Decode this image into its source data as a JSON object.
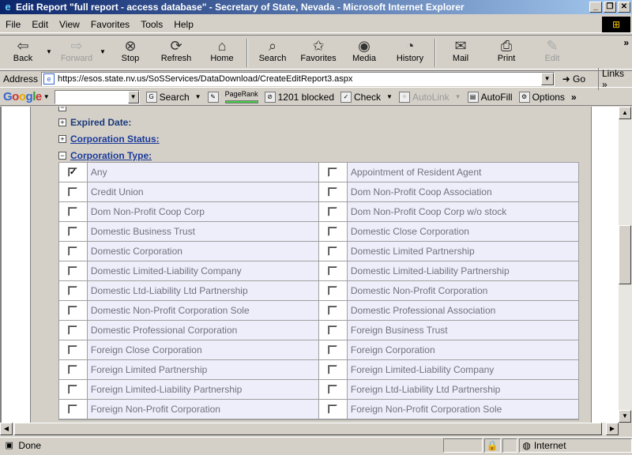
{
  "window": {
    "title": "Edit Report \"full report - access database\" - Secretary of State, Nevada - Microsoft Internet Explorer",
    "controls": [
      "_",
      "❐",
      "✕"
    ]
  },
  "menu": [
    "File",
    "Edit",
    "View",
    "Favorites",
    "Tools",
    "Help"
  ],
  "toolbar": {
    "back": "Back",
    "forward": "Forward",
    "stop": "Stop",
    "refresh": "Refresh",
    "home": "Home",
    "search": "Search",
    "favorites": "Favorites",
    "media": "Media",
    "history": "History",
    "mail": "Mail",
    "print": "Print",
    "edit": "Edit",
    "more": "»"
  },
  "address": {
    "label": "Address",
    "url": "https://esos.state.nv.us/SoSServices/DataDownload/CreateEditReport3.aspx",
    "go": "Go",
    "links": "Links »"
  },
  "googlebar": {
    "logo": [
      "G",
      "o",
      "o",
      "g",
      "l",
      "e"
    ],
    "search": "Search",
    "pagerank": "PageRank",
    "blocked": "1201 blocked",
    "check": "Check",
    "autolink": "AutoLink",
    "autofill": "AutoFill",
    "options": "Options",
    "more": "»"
  },
  "form": {
    "sections": {
      "expired": "Expired Date:",
      "status": "Corporation Status:",
      "type": "Corporation Type:"
    },
    "rows": [
      {
        "left": {
          "label": "Any",
          "checked": true
        },
        "right": {
          "label": "Appointment of Resident Agent",
          "checked": false
        }
      },
      {
        "left": {
          "label": "Credit Union",
          "checked": false
        },
        "right": {
          "label": "Dom Non-Profit Coop Association",
          "checked": false
        }
      },
      {
        "left": {
          "label": "Dom Non-Profit Coop Corp",
          "checked": false
        },
        "right": {
          "label": "Dom Non-Profit Coop Corp w/o stock",
          "checked": false
        }
      },
      {
        "left": {
          "label": "Domestic Business Trust",
          "checked": false
        },
        "right": {
          "label": "Domestic Close Corporation",
          "checked": false
        }
      },
      {
        "left": {
          "label": "Domestic Corporation",
          "checked": false
        },
        "right": {
          "label": "Domestic Limited Partnership",
          "checked": false
        }
      },
      {
        "left": {
          "label": "Domestic Limited-Liability Company",
          "checked": false
        },
        "right": {
          "label": "Domestic Limited-Liability Partnership",
          "checked": false
        }
      },
      {
        "left": {
          "label": "Domestic Ltd-Liability Ltd Partnership",
          "checked": false
        },
        "right": {
          "label": "Domestic Non-Profit Corporation",
          "checked": false
        }
      },
      {
        "left": {
          "label": "Domestic Non-Profit Corporation Sole",
          "checked": false
        },
        "right": {
          "label": "Domestic Professional Association",
          "checked": false
        }
      },
      {
        "left": {
          "label": "Domestic Professional Corporation",
          "checked": false
        },
        "right": {
          "label": "Foreign Business Trust",
          "checked": false
        }
      },
      {
        "left": {
          "label": "Foreign Close Corporation",
          "checked": false
        },
        "right": {
          "label": "Foreign Corporation",
          "checked": false
        }
      },
      {
        "left": {
          "label": "Foreign Limited Partnership",
          "checked": false
        },
        "right": {
          "label": "Foreign Limited-Liability Company",
          "checked": false
        }
      },
      {
        "left": {
          "label": "Foreign Limited-Liability Partnership",
          "checked": false
        },
        "right": {
          "label": "Foreign Ltd-Liability Ltd Partnership",
          "checked": false
        }
      },
      {
        "left": {
          "label": "Foreign Non-Profit Corporation",
          "checked": false
        },
        "right": {
          "label": "Foreign Non-Profit Corporation Sole",
          "checked": false
        }
      }
    ]
  },
  "status": {
    "text": "Done",
    "zone": "Internet"
  }
}
